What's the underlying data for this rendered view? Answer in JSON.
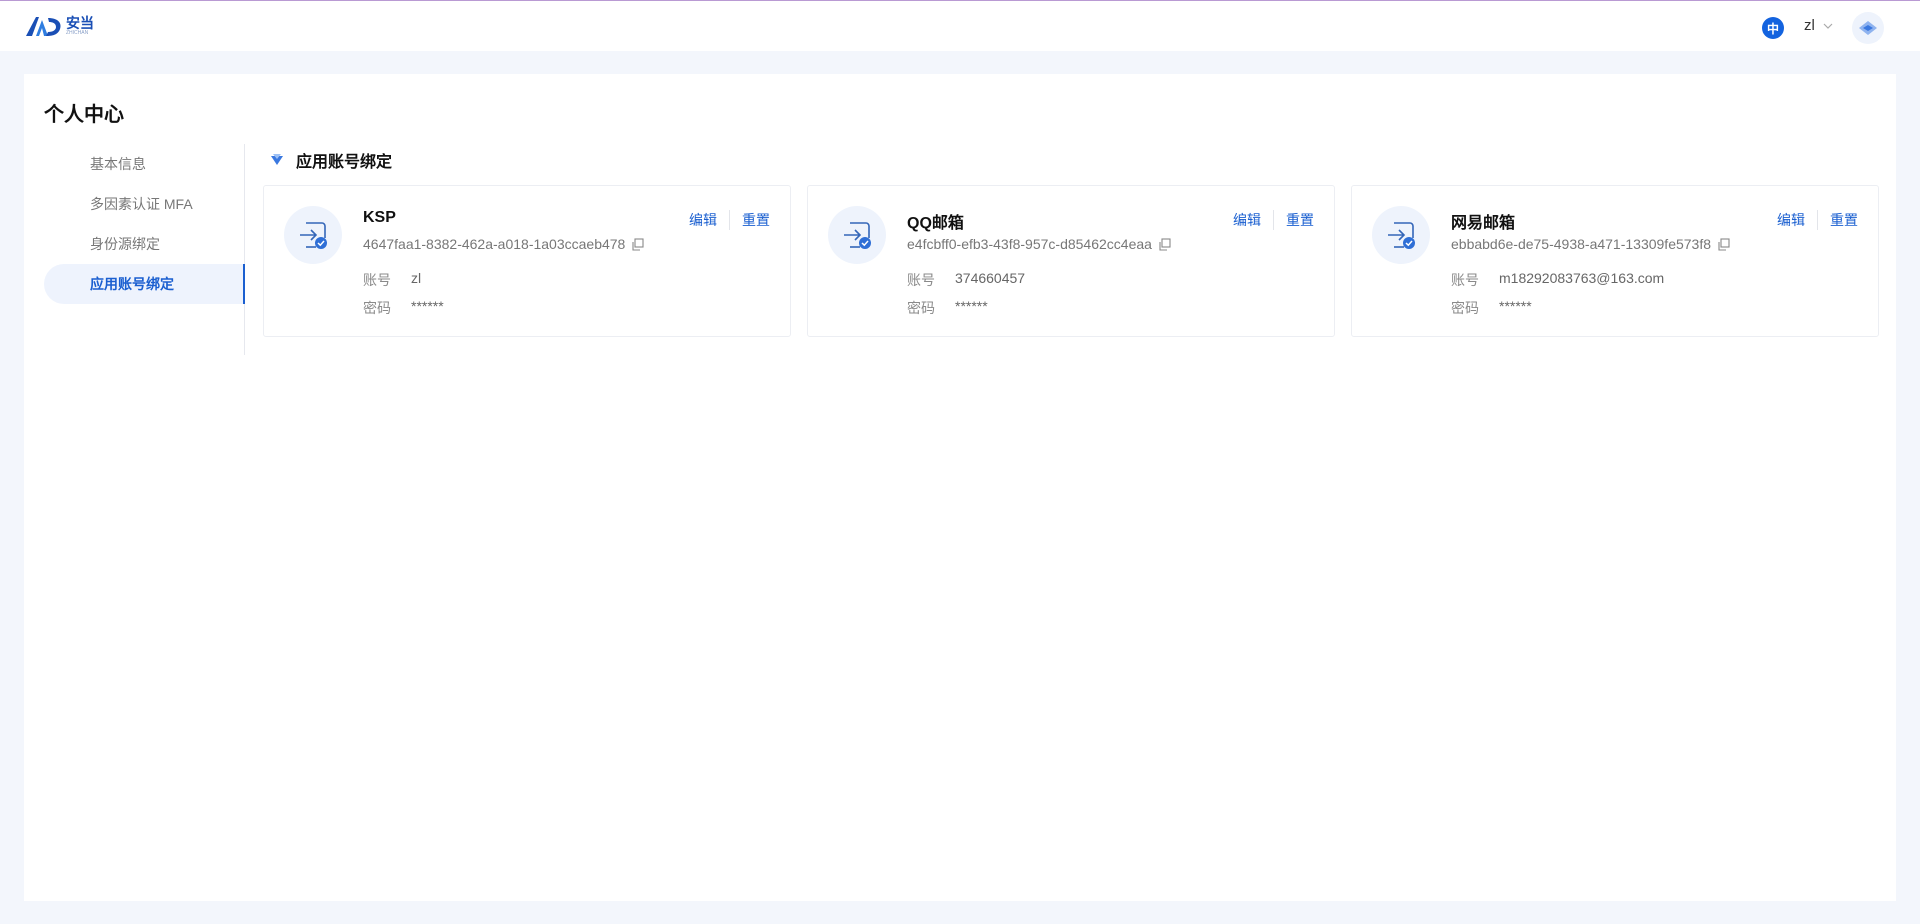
{
  "header": {
    "logo_cn": "安当",
    "logo_en": "ZHICHAN",
    "lang": "中",
    "user": "zl"
  },
  "page": {
    "title": "个人中心"
  },
  "sidebar": {
    "items": [
      {
        "label": "基本信息",
        "active": false
      },
      {
        "label": "多因素认证 MFA",
        "active": false
      },
      {
        "label": "身份源绑定",
        "active": false
      },
      {
        "label": "应用账号绑定",
        "active": true
      }
    ]
  },
  "section": {
    "title": "应用账号绑定"
  },
  "cards": [
    {
      "name": "KSP",
      "id": "4647faa1-8382-462a-a018-1a03ccaeb478",
      "account_label": "账号",
      "account": "zl",
      "password_label": "密码",
      "password": "******",
      "edit": "编辑",
      "reset": "重置"
    },
    {
      "name": "QQ邮箱",
      "id": "e4fcbff0-efb3-43f8-957c-d85462cc4eaa",
      "account_label": "账号",
      "account": "374660457",
      "password_label": "密码",
      "password": "******",
      "edit": "编辑",
      "reset": "重置"
    },
    {
      "name": "网易邮箱",
      "id": "ebbabd6e-de75-4938-a471-13309fe573f8",
      "account_label": "账号",
      "account": "m18292083763@163.com",
      "password_label": "密码",
      "password": "******",
      "edit": "编辑",
      "reset": "重置"
    }
  ],
  "colors": {
    "accent": "#1a5fd0",
    "background": "#f3f6fc"
  }
}
